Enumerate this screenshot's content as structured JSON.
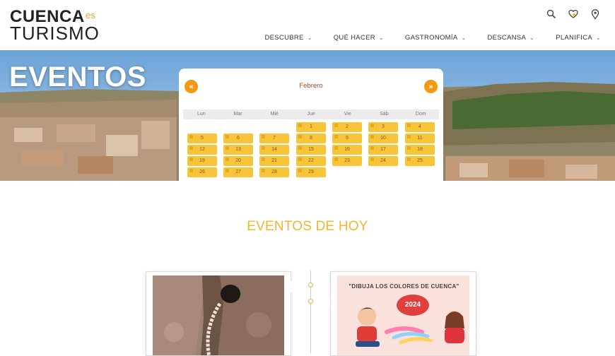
{
  "brand": {
    "line1": "CUENCA",
    "line2": "es",
    "line3": "TURISMO"
  },
  "top_icons": [
    "search-icon",
    "heart-icon",
    "map-pin-icon"
  ],
  "nav": [
    {
      "label": "DESCUBRE"
    },
    {
      "label": "QUÉ HACER"
    },
    {
      "label": "GASTRONOMÍA"
    },
    {
      "label": "DESCANSA"
    },
    {
      "label": "PLANIFICA"
    }
  ],
  "hero": {
    "title": "EVENTOS"
  },
  "calendar": {
    "prev": "«",
    "next": "»",
    "month": "Febrero",
    "weekdays": [
      "Lun",
      "Mar",
      "Mié",
      "Jue",
      "Vie",
      "Sáb",
      "Dom"
    ],
    "days": [
      "1",
      "2",
      "3",
      "4",
      "5",
      "6",
      "7",
      "8",
      "9",
      "10",
      "11",
      "12",
      "13",
      "14",
      "15",
      "16",
      "17",
      "18",
      "19",
      "20",
      "21",
      "22",
      "23",
      "24",
      "25",
      "26",
      "27",
      "28",
      "29"
    ]
  },
  "section": {
    "title": "EVENTOS DE HOY"
  },
  "events": [
    {
      "image": "rock-hole-photo"
    },
    {
      "poster_title": "\"DIBUJA LOS COLORES DE CUENCA\"",
      "poster_year": "2024"
    }
  ],
  "colors": {
    "accent": "#f0b62d",
    "button": "#f29a12",
    "day_bg": "#f8c53a",
    "month": "#a84a20"
  }
}
